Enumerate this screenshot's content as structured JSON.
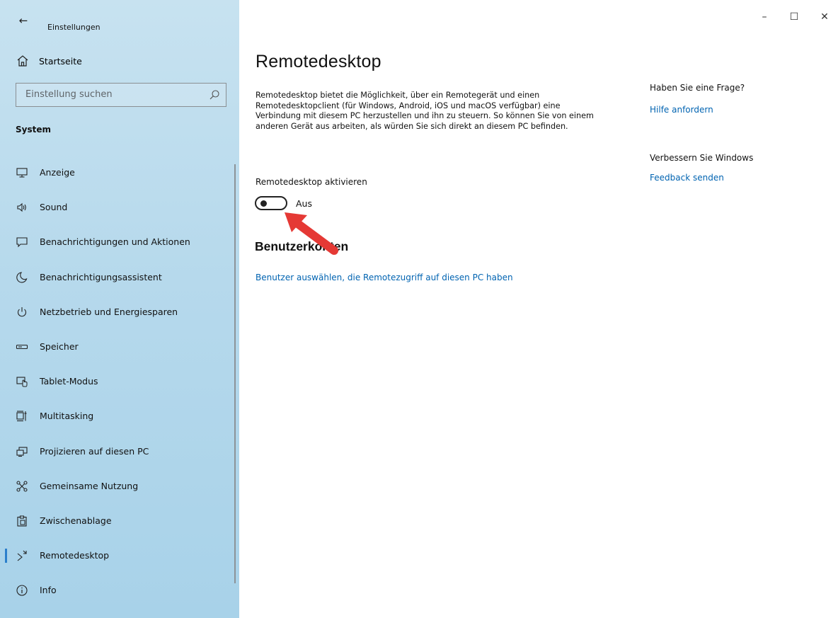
{
  "window": {
    "back_glyph": "←",
    "title": "Einstellungen",
    "controls": {
      "minimize": "–",
      "maximize": "☐",
      "close": "✕"
    }
  },
  "sidebar": {
    "home_label": "Startseite",
    "search_placeholder": "Einstellung suchen",
    "section_title": "System",
    "items": [
      {
        "label": "Anzeige",
        "icon": "display-icon"
      },
      {
        "label": "Sound",
        "icon": "speaker-icon"
      },
      {
        "label": "Benachrichtigungen und Aktionen",
        "icon": "notification-icon"
      },
      {
        "label": "Benachrichtigungsassistent",
        "icon": "moon-icon"
      },
      {
        "label": "Netzbetrieb und Energiesparen",
        "icon": "power-icon"
      },
      {
        "label": "Speicher",
        "icon": "storage-icon"
      },
      {
        "label": "Tablet-Modus",
        "icon": "tablet-mode-icon"
      },
      {
        "label": "Multitasking",
        "icon": "multitasking-icon"
      },
      {
        "label": "Projizieren auf diesen PC",
        "icon": "project-icon"
      },
      {
        "label": "Gemeinsame Nutzung",
        "icon": "share-icon"
      },
      {
        "label": "Zwischenablage",
        "icon": "clipboard-icon"
      },
      {
        "label": "Remotedesktop",
        "icon": "remote-desktop-icon",
        "active": true
      },
      {
        "label": "Info",
        "icon": "info-icon"
      }
    ]
  },
  "main": {
    "title": "Remotedesktop",
    "description": "Remotedesktop bietet die Möglichkeit, über ein Remotegerät und einen Remotedesktopclient (für Windows, Android, iOS und macOS verfügbar) eine Verbindung mit diesem PC herzustellen und ihn zu steuern. So können Sie von einem anderen Gerät aus arbeiten, als würden Sie sich direkt an diesem PC befinden.",
    "toggle_label": "Remotedesktop aktivieren",
    "toggle_state": "Aus",
    "toggle_on": false,
    "accounts_title": "Benutzerkonten",
    "accounts_link": "Benutzer auswählen, die Remotezugriff auf diesen PC haben"
  },
  "aside": {
    "help_question": "Haben Sie eine Frage?",
    "help_link": "Hilfe anfordern",
    "feedback_question": "Verbessern Sie Windows",
    "feedback_link": "Feedback senden"
  },
  "colors": {
    "accent": "#0063b1",
    "active_indicator": "#2b7fcc",
    "annotation_arrow": "#e53935"
  }
}
